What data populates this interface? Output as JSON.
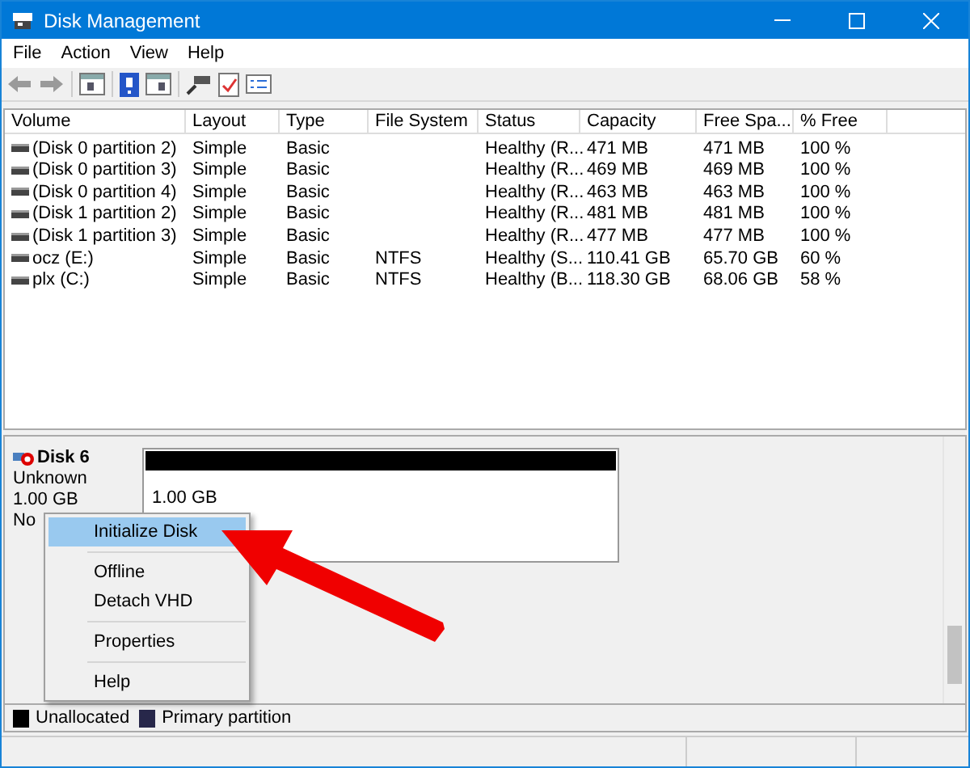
{
  "window": {
    "title": "Disk Management"
  },
  "menu": [
    "File",
    "Action",
    "View",
    "Help"
  ],
  "table": {
    "columns": [
      "Volume",
      "Layout",
      "Type",
      "File System",
      "Status",
      "Capacity",
      "Free Spa...",
      "% Free"
    ],
    "rows": [
      [
        "(Disk 0 partition 2)",
        "Simple",
        "Basic",
        "",
        "Healthy (R...",
        "471 MB",
        "471 MB",
        "100 %"
      ],
      [
        "(Disk 0 partition 3)",
        "Simple",
        "Basic",
        "",
        "Healthy (R...",
        "469 MB",
        "469 MB",
        "100 %"
      ],
      [
        "(Disk 0 partition 4)",
        "Simple",
        "Basic",
        "",
        "Healthy (R...",
        "463 MB",
        "463 MB",
        "100 %"
      ],
      [
        "(Disk 1 partition 2)",
        "Simple",
        "Basic",
        "",
        "Healthy (R...",
        "481 MB",
        "481 MB",
        "100 %"
      ],
      [
        "(Disk 1 partition 3)",
        "Simple",
        "Basic",
        "",
        "Healthy (R...",
        "477 MB",
        "477 MB",
        "100 %"
      ],
      [
        "ocz (E:)",
        "Simple",
        "Basic",
        "NTFS",
        "Healthy (S...",
        "110.41 GB",
        "65.70 GB",
        "60 %"
      ],
      [
        "plx (C:)",
        "Simple",
        "Basic",
        "NTFS",
        "Healthy (B...",
        "118.30 GB",
        "68.06 GB",
        "58 %"
      ]
    ]
  },
  "disk": {
    "name": "Disk 6",
    "type": "Unknown",
    "size": "1.00 GB",
    "status": "No",
    "partition": {
      "size": "1.00 GB"
    }
  },
  "context_menu": [
    {
      "label": "Initialize Disk",
      "selected": true
    },
    {
      "kind": "separator"
    },
    {
      "label": "Offline",
      "selected": false
    },
    {
      "label": "Detach VHD",
      "selected": false
    },
    {
      "kind": "separator"
    },
    {
      "label": "Properties",
      "selected": false
    },
    {
      "kind": "separator"
    },
    {
      "label": "Help",
      "selected": false
    }
  ],
  "legend": [
    {
      "label": "Unallocated",
      "color": "#000000"
    },
    {
      "label": "Primary partition",
      "color": "#27274a"
    }
  ]
}
